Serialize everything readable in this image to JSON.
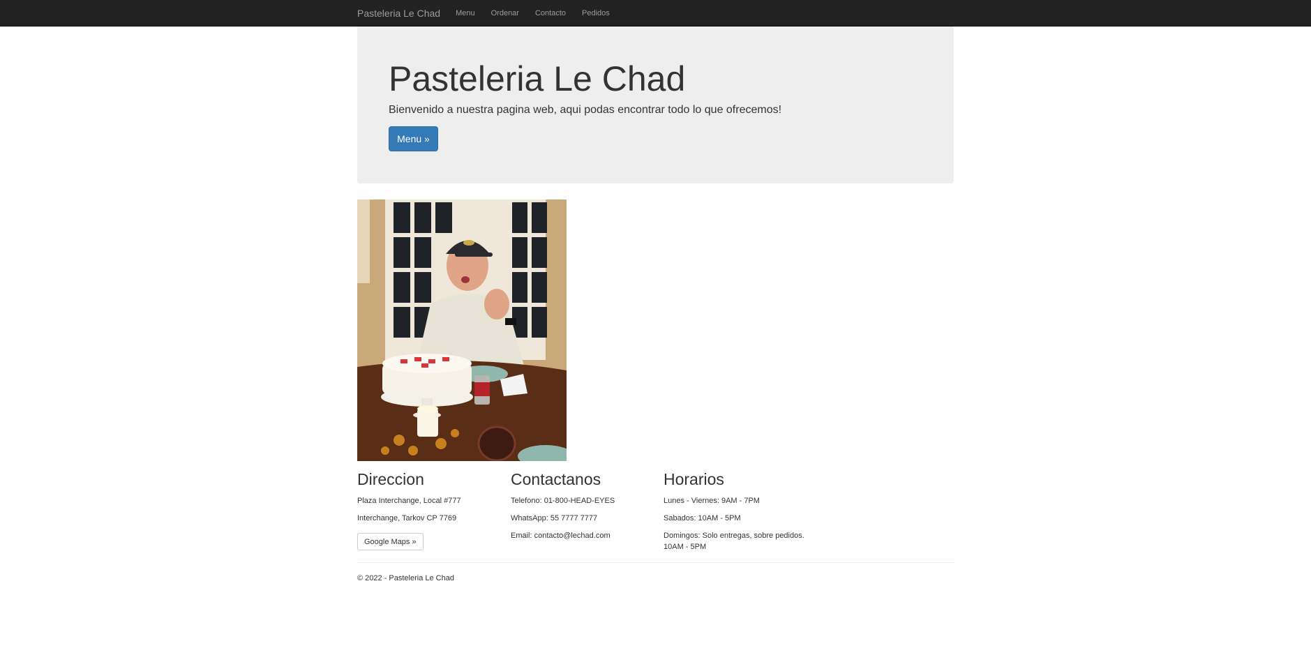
{
  "navbar": {
    "brand": "Pasteleria Le Chad",
    "links": [
      "Menu",
      "Ordenar",
      "Contacto",
      "Pedidos"
    ]
  },
  "hero": {
    "title": "Pasteleria Le Chad",
    "subtitle": "Bienvenido a nuestra pagina web, aqui podas encontrar todo lo que ofrecemos!",
    "button": "Menu »"
  },
  "direccion": {
    "heading": "Direccion",
    "lines": [
      "Plaza Interchange, Local #777",
      "Interchange, Tarkov CP 7769"
    ],
    "button": "Google Maps »"
  },
  "contacto": {
    "heading": "Contactanos",
    "lines": [
      "Telefono: 01-800-HEAD-EYES",
      "WhatsApp: 55 7777 7777",
      "Email: contacto@lechad.com"
    ]
  },
  "horarios": {
    "heading": "Horarios",
    "lines": [
      "Lunes - Viernes: 9AM - 7PM",
      "Sabados: 10AM - 5PM",
      "Domingos: Solo entregas, sobre pedidos.",
      "10AM - 5PM"
    ]
  },
  "footer": {
    "text": "© 2022 - Pasteleria Le Chad"
  },
  "colors": {
    "navbar_bg": "#222222",
    "jumbotron_bg": "#eeeeee",
    "primary": "#337ab7"
  }
}
